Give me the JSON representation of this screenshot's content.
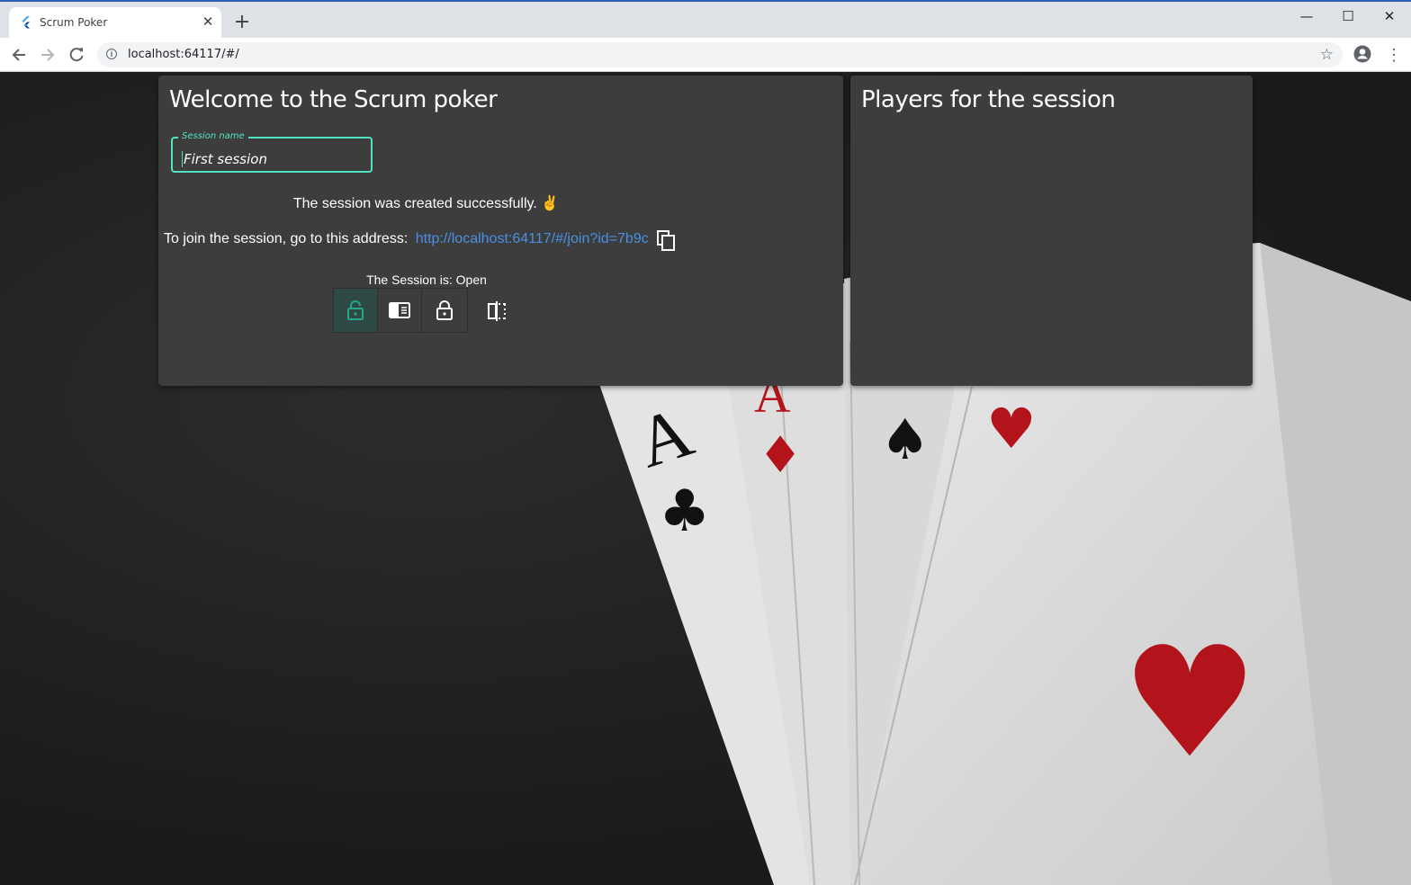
{
  "browser": {
    "tab_title": "Scrum Poker",
    "tab_close": "✕",
    "new_tab": "+",
    "url": "localhost:64117/#/",
    "window_controls": [
      "—",
      "☐",
      "✕"
    ]
  },
  "left_panel": {
    "title": "Welcome to the Scrum poker",
    "session_field": {
      "label": "Session name",
      "value": "First session"
    },
    "success_message": "The session was created successfully. ✌",
    "join_prefix": "To join the session, go to this address:",
    "join_link": "http://localhost:64117/#/join?id=7b9c",
    "session_status": "The Session is: Open",
    "toggle_buttons": [
      {
        "icon": "lock-open-icon",
        "active": true
      },
      {
        "icon": "card-view-icon",
        "active": false
      },
      {
        "icon": "lock-closed-icon",
        "active": false
      }
    ],
    "flip_icon": "flip-icon"
  },
  "right_panel": {
    "title": "Players for the session",
    "players": []
  },
  "colors": {
    "accent": "#50e3c2",
    "link": "#4a90e2",
    "panel": "#3d3d3d",
    "text": "#ffffff"
  }
}
